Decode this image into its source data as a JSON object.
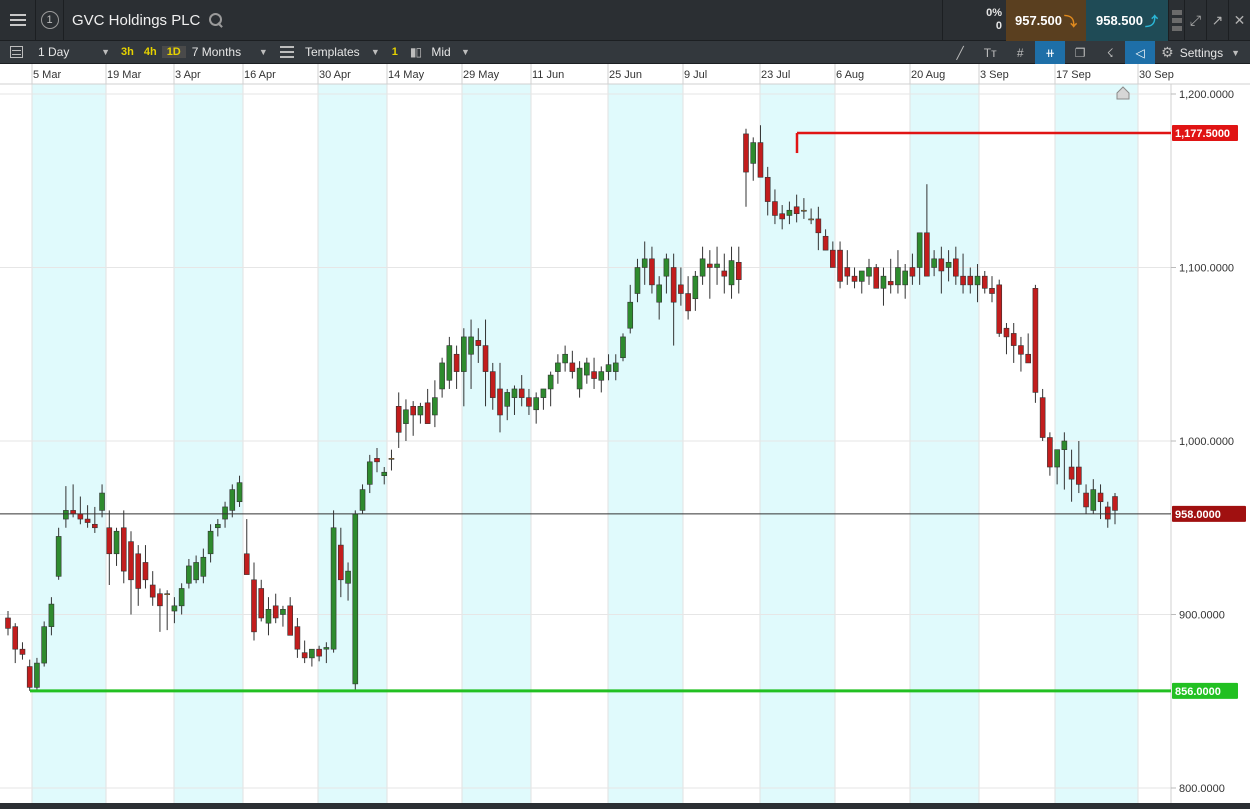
{
  "header": {
    "instrument": "GVC Holdings PLC",
    "link_number": "1",
    "change_pct": "0%",
    "change_value": "0",
    "sell_price": "957.500",
    "buy_price": "958.500"
  },
  "toolbar": {
    "interval": "1 Day",
    "quick_intervals": [
      "3h",
      "4h",
      "1D"
    ],
    "range": "7 Months",
    "templates": "Templates",
    "one": "1",
    "price_type": "Mid",
    "settings": "Settings"
  },
  "chart_data": {
    "type": "candlestick",
    "x_labels": [
      "5 Mar",
      "19 Mar",
      "3 Apr",
      "16 Apr",
      "30 Apr",
      "14 May",
      "29 May",
      "11 Jun",
      "25 Jun",
      "9 Jul",
      "23 Jul",
      "6 Aug",
      "20 Aug",
      "3 Sep",
      "17 Sep",
      "30 Sep"
    ],
    "y_ticks": [
      "1,200.0000",
      "1,100.0000",
      "1,000.0000",
      "900.0000",
      "800.0000"
    ],
    "y_range": [
      796,
      1210
    ],
    "lines": [
      {
        "label": "1,177.5000",
        "value": 1177.5,
        "color": "#e01414"
      },
      {
        "label": "958.0000",
        "value": 958,
        "color": "#a01010"
      },
      {
        "label": "856.0000",
        "value": 856,
        "color": "#22c022"
      }
    ],
    "colors": {
      "up": "#2e8b2e",
      "down": "#c21d1d",
      "band": "#e0fafc",
      "grid": "#e6e6e6",
      "neutral": "#e0a030"
    },
    "candles": [
      [
        898,
        902,
        888,
        892
      ],
      [
        893,
        895,
        872,
        880
      ],
      [
        880,
        884,
        874,
        877
      ],
      [
        870,
        874,
        856,
        858
      ],
      [
        858,
        875,
        856,
        872
      ],
      [
        872,
        896,
        870,
        893
      ],
      [
        893,
        910,
        888,
        906
      ],
      [
        922,
        950,
        920,
        945
      ],
      [
        955,
        974,
        950,
        960
      ],
      [
        960,
        975,
        956,
        958
      ],
      [
        958,
        968,
        952,
        955
      ],
      [
        955,
        963,
        950,
        953
      ],
      [
        952,
        962,
        947,
        950
      ],
      [
        960,
        975,
        956,
        970
      ],
      [
        950,
        960,
        917,
        935
      ],
      [
        935,
        950,
        928,
        948
      ],
      [
        950,
        960,
        918,
        925
      ],
      [
        942,
        948,
        900,
        920
      ],
      [
        935,
        940,
        905,
        915
      ],
      [
        930,
        940,
        915,
        920
      ],
      [
        917,
        925,
        905,
        910
      ],
      [
        912,
        915,
        890,
        905
      ],
      [
        912,
        914,
        891,
        912
      ],
      [
        902,
        910,
        895,
        905
      ],
      [
        905,
        918,
        900,
        915
      ],
      [
        918,
        932,
        915,
        928
      ],
      [
        920,
        934,
        918,
        930
      ],
      [
        922,
        938,
        918,
        933
      ],
      [
        935,
        952,
        930,
        948
      ],
      [
        950,
        955,
        945,
        952
      ],
      [
        955,
        965,
        950,
        962
      ],
      [
        960,
        975,
        956,
        972
      ],
      [
        965,
        980,
        962,
        976
      ],
      [
        935,
        955,
        925,
        923
      ],
      [
        920,
        930,
        885,
        890
      ],
      [
        915,
        920,
        896,
        898
      ],
      [
        895,
        910,
        888,
        903
      ],
      [
        905,
        912,
        895,
        898
      ],
      [
        900,
        905,
        893,
        903
      ],
      [
        905,
        910,
        890,
        888
      ],
      [
        893,
        898,
        875,
        880
      ],
      [
        878,
        885,
        872,
        875
      ],
      [
        875,
        880,
        870,
        880
      ],
      [
        880,
        882,
        873,
        876
      ],
      [
        880,
        884,
        872,
        881
      ],
      [
        880,
        960,
        878,
        950
      ],
      [
        940,
        950,
        910,
        920
      ],
      [
        918,
        930,
        908,
        925
      ],
      [
        860,
        960,
        856,
        958
      ],
      [
        960,
        975,
        958,
        972
      ],
      [
        975,
        992,
        970,
        988
      ],
      [
        990,
        996,
        982,
        988
      ],
      [
        980,
        985,
        975,
        982
      ],
      [
        990,
        995,
        983,
        990
      ],
      [
        1020,
        1028,
        996,
        1005
      ],
      [
        1010,
        1024,
        1000,
        1018
      ],
      [
        1020,
        1023,
        1003,
        1015
      ],
      [
        1015,
        1022,
        1010,
        1020
      ],
      [
        1022,
        1030,
        1015,
        1010
      ],
      [
        1015,
        1035,
        1008,
        1025
      ],
      [
        1030,
        1048,
        1025,
        1045
      ],
      [
        1035,
        1060,
        1030,
        1055
      ],
      [
        1050,
        1055,
        1030,
        1040
      ],
      [
        1040,
        1065,
        1020,
        1060
      ],
      [
        1050,
        1070,
        1030,
        1060
      ],
      [
        1058,
        1065,
        1045,
        1055
      ],
      [
        1055,
        1070,
        1020,
        1040
      ],
      [
        1040,
        1045,
        1018,
        1025
      ],
      [
        1030,
        1045,
        1005,
        1015
      ],
      [
        1020,
        1030,
        1012,
        1028
      ],
      [
        1025,
        1032,
        1015,
        1030
      ],
      [
        1030,
        1038,
        1020,
        1025
      ],
      [
        1025,
        1030,
        1015,
        1020
      ],
      [
        1018,
        1028,
        1010,
        1025
      ],
      [
        1025,
        1030,
        1018,
        1030
      ],
      [
        1030,
        1040,
        1020,
        1038
      ],
      [
        1040,
        1050,
        1033,
        1045
      ],
      [
        1045,
        1055,
        1040,
        1050
      ],
      [
        1045,
        1052,
        1036,
        1040
      ],
      [
        1030,
        1046,
        1025,
        1042
      ],
      [
        1038,
        1048,
        1033,
        1045
      ],
      [
        1040,
        1048,
        1030,
        1036
      ],
      [
        1035,
        1043,
        1028,
        1040
      ],
      [
        1040,
        1050,
        1035,
        1044
      ],
      [
        1040,
        1050,
        1035,
        1045
      ],
      [
        1048,
        1062,
        1046,
        1060
      ],
      [
        1065,
        1090,
        1062,
        1080
      ],
      [
        1085,
        1105,
        1080,
        1100
      ],
      [
        1100,
        1115,
        1090,
        1105
      ],
      [
        1105,
        1112,
        1085,
        1090
      ],
      [
        1080,
        1095,
        1070,
        1090
      ],
      [
        1095,
        1108,
        1085,
        1105
      ],
      [
        1100,
        1108,
        1055,
        1080
      ],
      [
        1090,
        1100,
        1078,
        1085
      ],
      [
        1085,
        1095,
        1070,
        1075
      ],
      [
        1082,
        1098,
        1075,
        1095
      ],
      [
        1095,
        1112,
        1090,
        1105
      ],
      [
        1102,
        1110,
        1082,
        1100
      ],
      [
        1100,
        1112,
        1090,
        1102
      ],
      [
        1098,
        1108,
        1085,
        1095
      ],
      [
        1090,
        1112,
        1082,
        1104
      ],
      [
        1103,
        1112,
        1085,
        1093
      ],
      [
        1177,
        1180,
        1135,
        1155
      ],
      [
        1160,
        1175,
        1150,
        1172
      ],
      [
        1172,
        1182,
        1152,
        1152
      ],
      [
        1152,
        1158,
        1130,
        1138
      ],
      [
        1138,
        1145,
        1125,
        1130
      ],
      [
        1131,
        1136,
        1122,
        1128
      ],
      [
        1130,
        1138,
        1125,
        1133
      ],
      [
        1135,
        1142,
        1126,
        1131
      ],
      [
        1133,
        1140,
        1128,
        1133
      ],
      [
        1128,
        1134,
        1125,
        1128
      ],
      [
        1128,
        1135,
        1110,
        1120
      ],
      [
        1118,
        1122,
        1110,
        1110
      ],
      [
        1110,
        1115,
        1100,
        1100
      ],
      [
        1110,
        1115,
        1088,
        1092
      ],
      [
        1100,
        1110,
        1090,
        1095
      ],
      [
        1095,
        1100,
        1088,
        1092
      ],
      [
        1092,
        1098,
        1085,
        1098
      ],
      [
        1095,
        1105,
        1090,
        1100
      ],
      [
        1100,
        1102,
        1090,
        1088
      ],
      [
        1088,
        1100,
        1078,
        1095
      ],
      [
        1092,
        1105,
        1085,
        1090
      ],
      [
        1090,
        1110,
        1085,
        1100
      ],
      [
        1090,
        1102,
        1082,
        1098
      ],
      [
        1100,
        1108,
        1090,
        1095
      ],
      [
        1100,
        1108,
        1090,
        1120
      ],
      [
        1120,
        1148,
        1110,
        1095
      ],
      [
        1100,
        1110,
        1095,
        1105
      ],
      [
        1105,
        1112,
        1085,
        1098
      ],
      [
        1100,
        1110,
        1092,
        1103
      ],
      [
        1105,
        1112,
        1090,
        1095
      ],
      [
        1095,
        1108,
        1085,
        1090
      ],
      [
        1095,
        1100,
        1085,
        1090
      ],
      [
        1090,
        1102,
        1080,
        1095
      ],
      [
        1095,
        1098,
        1085,
        1088
      ],
      [
        1088,
        1095,
        1080,
        1085
      ],
      [
        1090,
        1093,
        1060,
        1062
      ],
      [
        1065,
        1068,
        1050,
        1060
      ],
      [
        1062,
        1068,
        1045,
        1055
      ],
      [
        1055,
        1060,
        1040,
        1050
      ],
      [
        1050,
        1062,
        1045,
        1045
      ],
      [
        1088,
        1090,
        1022,
        1028
      ],
      [
        1025,
        1030,
        1000,
        1002
      ],
      [
        1002,
        1005,
        980,
        985
      ],
      [
        985,
        995,
        975,
        995
      ],
      [
        995,
        1005,
        972,
        1000
      ],
      [
        985,
        995,
        965,
        978
      ],
      [
        985,
        1000,
        970,
        975
      ],
      [
        970,
        975,
        958,
        962
      ],
      [
        960,
        978,
        958,
        972
      ],
      [
        970,
        975,
        955,
        965
      ],
      [
        962,
        965,
        950,
        955
      ],
      [
        968,
        970,
        952,
        960
      ]
    ]
  }
}
